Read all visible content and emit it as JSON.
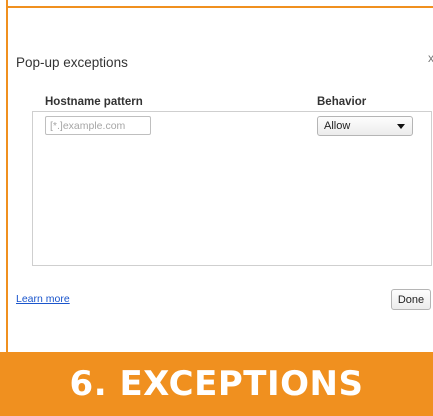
{
  "dialog": {
    "title": "Pop-up exceptions",
    "close_label": "x"
  },
  "table": {
    "columns": [
      "Hostname pattern",
      "Behavior"
    ],
    "host_placeholder": "[*.]example.com",
    "host_value": "",
    "behavior_selected": "Allow"
  },
  "footer": {
    "learn_more": "Learn more",
    "done_label": "Done"
  },
  "banner": {
    "text": "6. EXCEPTIONS"
  },
  "colors": {
    "accent": "#f0901f",
    "link": "#1a55cc"
  },
  "icons": {
    "close": "close-icon",
    "dropdown": "chevron-down-icon"
  }
}
